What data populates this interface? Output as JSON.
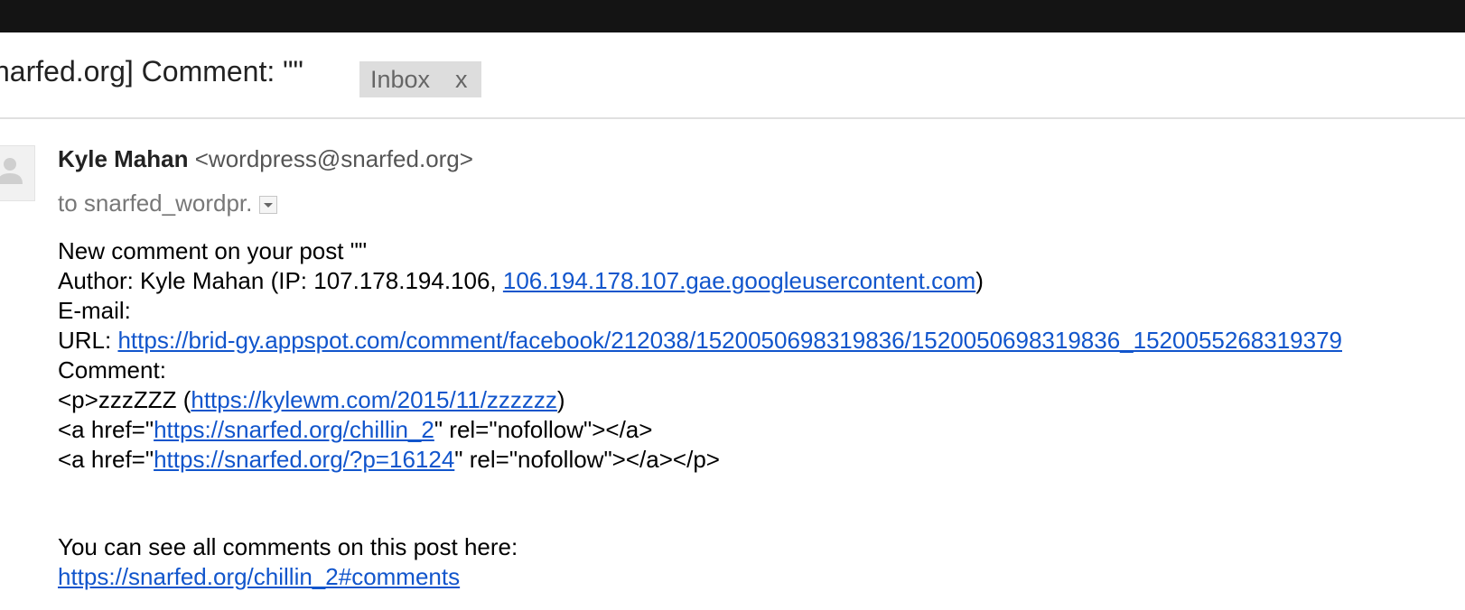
{
  "subject": {
    "text": "narfed.org] Comment: \"\"",
    "label_chip": "Inbox",
    "label_remove": "x"
  },
  "sender": {
    "name": "Kyle Mahan",
    "email": "<wordpress@snarfed.org>"
  },
  "recipient": {
    "text": "to snarfed_wordpr."
  },
  "body": {
    "line1": "New comment on your post \"\"",
    "author_prefix": "Author: Kyle Mahan (IP: 107.178.194.106, ",
    "author_host": "106.194.178.107.gae.googleusercontent.com",
    "author_suffix": ")",
    "email_line": "E-mail:",
    "url_prefix": "URL: ",
    "url_link": "https://brid-gy.appspot.com/comment/facebook/212038/1520050698319836/1520050698319836_1520055268319379",
    "comment_label": "Comment:",
    "p_prefix": "<p>zzzZZZ (",
    "p_link": "https://kylewm.com/2015/11/zzzzzz",
    "p_suffix": ")",
    "a1_prefix": "<a href=\"",
    "a1_link": "https://snarfed.org/chillin_2",
    "a1_suffix": "\" rel=\"nofollow\"></a>",
    "a2_prefix": "<a href=\"",
    "a2_link": "https://snarfed.org/?p=16124",
    "a2_suffix": "\" rel=\"nofollow\"></a></p>",
    "see_all": "You can see all comments on this post here:",
    "see_all_link": "https://snarfed.org/chillin_2#comments"
  },
  "colors": {
    "topbar": "#141414",
    "link": "#1155cc",
    "chip_bg": "#dddddd"
  }
}
